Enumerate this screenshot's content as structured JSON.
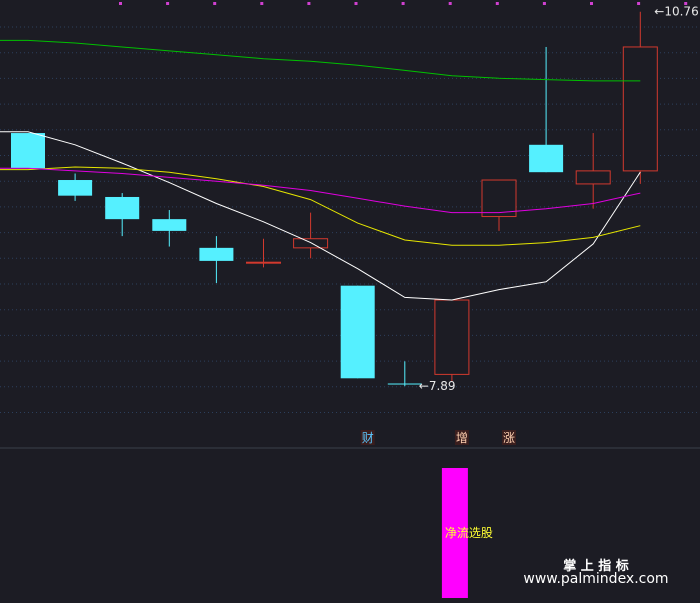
{
  "chart_data": [
    {
      "type": "candlestick",
      "ylim": [
        7.5,
        10.85
      ],
      "candles": [
        {
          "open": 9.83,
          "close": 9.56,
          "high": 9.83,
          "low": 9.56,
          "color": "cyan"
        },
        {
          "open": 9.47,
          "close": 9.35,
          "high": 9.52,
          "low": 9.31,
          "color": "cyan"
        },
        {
          "open": 9.34,
          "close": 9.17,
          "high": 9.37,
          "low": 9.04,
          "color": "cyan"
        },
        {
          "open": 9.17,
          "close": 9.08,
          "high": 9.24,
          "low": 8.96,
          "color": "cyan"
        },
        {
          "open": 8.95,
          "close": 8.85,
          "high": 9.04,
          "low": 8.68,
          "color": "cyan"
        },
        {
          "open": 8.84,
          "close": 8.84,
          "high": 9.02,
          "low": 8.8,
          "color": "red"
        },
        {
          "open": 8.95,
          "close": 9.02,
          "high": 9.22,
          "low": 8.87,
          "color": "red"
        },
        {
          "open": 8.66,
          "close": 7.95,
          "high": 8.66,
          "low": 7.95,
          "color": "cyan"
        },
        {
          "open": 7.91,
          "close": 7.91,
          "high": 8.08,
          "low": 7.89,
          "color": "cyan"
        },
        {
          "open": 7.98,
          "close": 8.55,
          "high": 8.55,
          "low": 7.93,
          "color": "red"
        },
        {
          "open": 9.19,
          "close": 9.47,
          "high": 9.47,
          "low": 9.08,
          "color": "red"
        },
        {
          "open": 9.74,
          "close": 9.53,
          "high": 10.49,
          "low": 9.53,
          "color": "cyan"
        },
        {
          "open": 9.44,
          "close": 9.54,
          "high": 9.83,
          "low": 9.25,
          "color": "red"
        },
        {
          "open": 9.54,
          "close": 10.49,
          "high": 10.76,
          "low": 9.44,
          "color": "red"
        }
      ],
      "ma_lines": [
        {
          "color": "#ffffff",
          "values": [
            9.84,
            9.74,
            9.6,
            9.45,
            9.29,
            9.15,
            8.99,
            8.79,
            8.57,
            8.55,
            8.63,
            8.69,
            8.98,
            9.53
          ]
        },
        {
          "color": "#e6e600",
          "values": [
            9.55,
            9.57,
            9.56,
            9.53,
            9.48,
            9.42,
            9.32,
            9.14,
            9.01,
            8.97,
            8.97,
            8.99,
            9.03,
            9.12
          ]
        },
        {
          "color": "#e000e0",
          "values": [
            9.56,
            9.54,
            9.52,
            9.49,
            9.46,
            9.43,
            9.39,
            9.33,
            9.27,
            9.22,
            9.22,
            9.25,
            9.29,
            9.37
          ]
        },
        {
          "color": "#00c000",
          "values": [
            10.54,
            10.52,
            10.49,
            10.46,
            10.43,
            10.4,
            10.38,
            10.35,
            10.31,
            10.27,
            10.25,
            10.24,
            10.23,
            10.23
          ]
        }
      ],
      "annotations": [
        {
          "text": "10.76",
          "value": 10.76,
          "candle": 13
        },
        {
          "text": "7.89",
          "value": 7.89,
          "candle": 8
        }
      ],
      "markers": [
        {
          "text": "财",
          "candle": 7,
          "color": "#5cc8ff"
        },
        {
          "text": "增",
          "candle": 9,
          "color": "#ffd0b0"
        },
        {
          "text": "涨",
          "candle": 10,
          "color": "#ffd0b0"
        }
      ]
    },
    {
      "type": "bar",
      "title": "净流选股",
      "values": [
        0,
        0,
        0,
        0,
        0,
        0,
        0,
        0,
        0,
        1,
        0,
        0,
        0,
        0
      ],
      "bar_color": "#ff00ff"
    }
  ],
  "watermark": {
    "line1": "掌 上 指 标",
    "line2": "www.palmindex.com"
  },
  "colors": {
    "background": "#1c1c24",
    "up": "#d2392e",
    "down": "#55f0ff",
    "grid": "#2c3f5c"
  }
}
